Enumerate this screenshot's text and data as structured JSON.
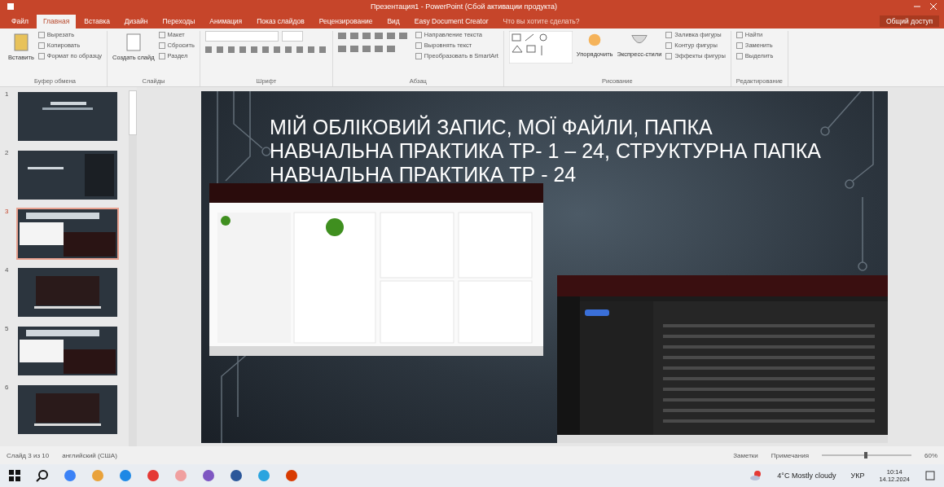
{
  "window": {
    "title": "Презентация1 - PowerPoint (Сбой активации продукта)"
  },
  "tabs": [
    {
      "label": "Файл",
      "selected": false
    },
    {
      "label": "Главная",
      "selected": true
    },
    {
      "label": "Вставка",
      "selected": false
    },
    {
      "label": "Дизайн",
      "selected": false
    },
    {
      "label": "Переходы",
      "selected": false
    },
    {
      "label": "Анимация",
      "selected": false
    },
    {
      "label": "Показ слайдов",
      "selected": false
    },
    {
      "label": "Рецензирование",
      "selected": false
    },
    {
      "label": "Вид",
      "selected": false
    },
    {
      "label": "Easy Document Creator",
      "selected": false
    }
  ],
  "tell_me": {
    "placeholder": "Что вы хотите сделать?"
  },
  "share": "Общий доступ",
  "ribbon": [
    {
      "kind": "clipboard",
      "label": "Буфер обмена",
      "big": "Вставить",
      "items": [
        "Вырезать",
        "Копировать",
        "Формат по образцу"
      ]
    },
    {
      "kind": "slides",
      "label": "Слайды",
      "big": "Создать слайд",
      "items": [
        "Макет",
        "Сбросить",
        "Раздел"
      ]
    },
    {
      "kind": "font",
      "label": "Шрифт"
    },
    {
      "kind": "paragraph",
      "label": "Абзац",
      "items": [
        "Направление текста",
        "Выровнять текст",
        "Преобразовать в SmartArt"
      ]
    },
    {
      "kind": "drawing",
      "label": "Рисование",
      "big": "Упорядочить",
      "big2": "Экспресс-стили",
      "items": [
        "Заливка фигуры",
        "Контур фигуры",
        "Эффекты фигуры"
      ]
    },
    {
      "kind": "editing",
      "label": "Редактирование",
      "items": [
        "Найти",
        "Заменить",
        "Выделить"
      ]
    }
  ],
  "thumbnails": [
    {
      "number": "1",
      "selected": false,
      "kind": "title"
    },
    {
      "number": "2",
      "selected": false,
      "kind": "list"
    },
    {
      "number": "3",
      "selected": true,
      "kind": "shots"
    },
    {
      "number": "4",
      "selected": false,
      "kind": "screen"
    },
    {
      "number": "5",
      "selected": false,
      "kind": "shots"
    },
    {
      "number": "6",
      "selected": false,
      "kind": "screen"
    }
  ],
  "slide": {
    "title": "МІЙ ОБЛІКОВИЙ ЗАПИС, МОЇ ФАЙЛИ, ПАПКА НАВЧАЛЬНА ПРАКТИКА ТР- 1 – 24, СТРУКТУРНА ПАПКА НАВЧАЛЬНА ПРАКТИКА ТР - 24"
  },
  "status_bar": {
    "slide": "Слайд 3 из 10",
    "language": "английский (США)",
    "notes": "Заметки",
    "comments": "Примечания",
    "zoom": "60%"
  },
  "taskbar": {
    "weather": "4°C  Mostly cloudy",
    "language": "УКР",
    "time": "10:14",
    "date": "14.12.2024"
  }
}
